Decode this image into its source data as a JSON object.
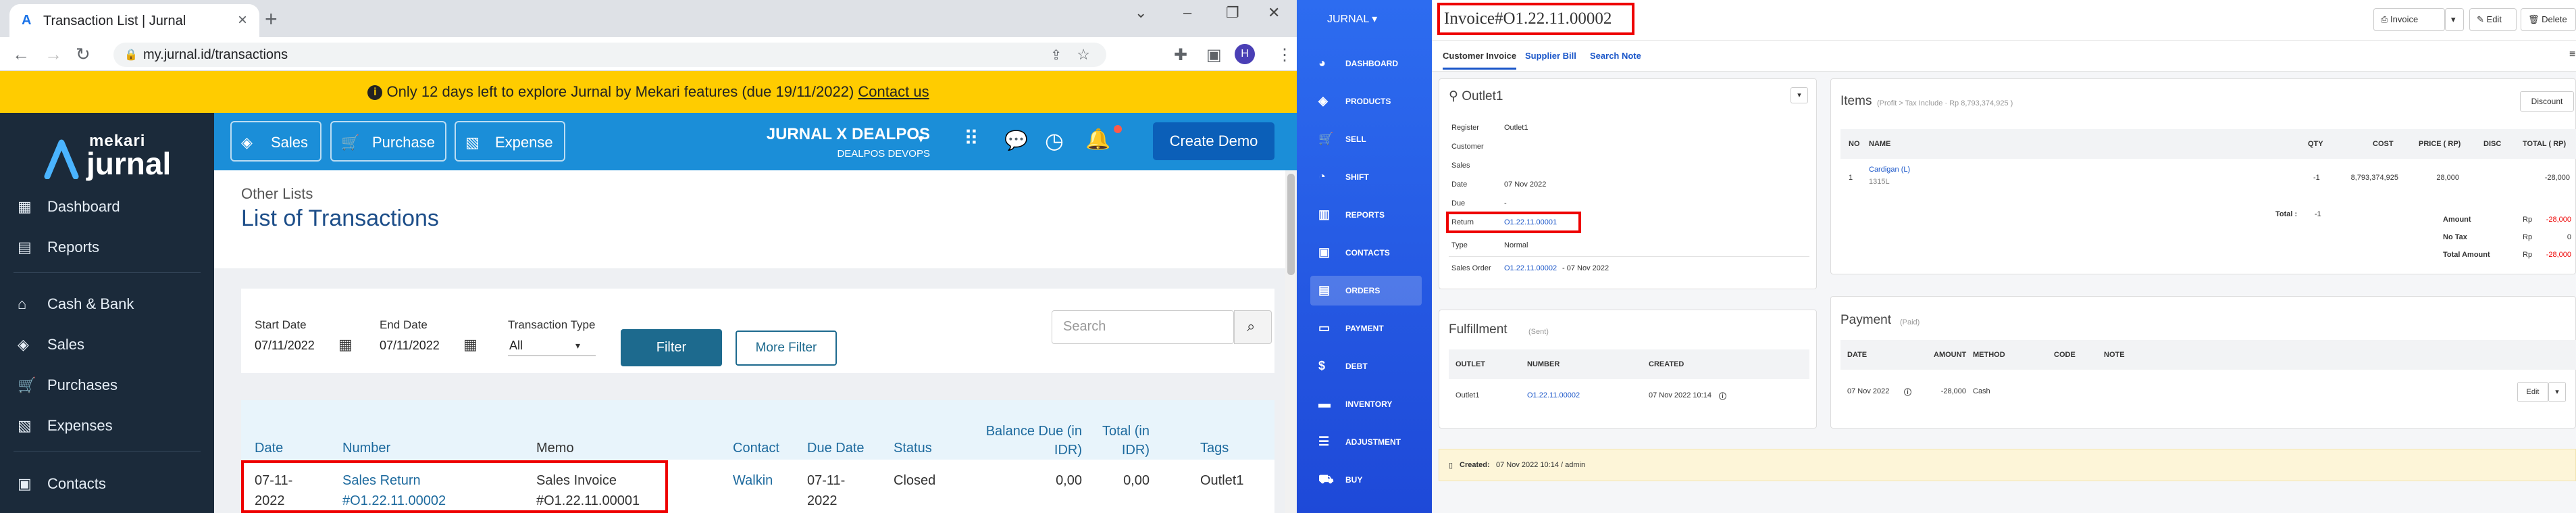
{
  "browser": {
    "tab_title": "Transaction List | Jurnal",
    "url": "my.jurnal.id/transactions",
    "profile_initial": "H"
  },
  "banner": {
    "text": "Only 12 days left to explore Jurnal by Mekari features (due 19/11/2022)",
    "link": "Contact us"
  },
  "jurnal_sidebar": {
    "logo_top": "mekari",
    "logo_bottom": "jurnal",
    "items": [
      "Dashboard",
      "Reports",
      "Cash & Bank",
      "Sales",
      "Purchases",
      "Expenses",
      "Contacts"
    ]
  },
  "jurnal_header": {
    "buttons": [
      "Sales",
      "Purchase",
      "Expense"
    ],
    "company_name": "JURNAL X DEALPOS",
    "company_sub": "DEALPOS DEVOPS",
    "demo_button": "Create Demo"
  },
  "page": {
    "breadcrumb": "Other Lists",
    "title": "List of Transactions"
  },
  "filters": {
    "start_label": "Start Date",
    "start_value": "07/11/2022",
    "end_label": "End Date",
    "end_value": "07/11/2022",
    "type_label": "Transaction Type",
    "type_value": "All",
    "filter_button": "Filter",
    "more_button": "More Filter",
    "search_placeholder": "Search"
  },
  "table": {
    "headers": {
      "date": "Date",
      "number": "Number",
      "memo": "Memo",
      "contact": "Contact",
      "due_date": "Due Date",
      "status": "Status",
      "balance_due": "Balance Due (in IDR)",
      "total": "Total (in IDR)",
      "tags": "Tags"
    },
    "row": {
      "date": "07-11-2022",
      "number": "Sales Return #O1.22.11.00002",
      "memo": "Sales Invoice #O1.22.11.00001",
      "contact": "Walkin",
      "due_date": "07-11-2022",
      "status": "Closed",
      "balance_due": "0,00",
      "total": "0,00",
      "tags": "Outlet1"
    }
  },
  "dealpos_sidebar": {
    "brand": "JURNAL",
    "items": [
      "DASHBOARD",
      "PRODUCTS",
      "SELL",
      "SHIFT",
      "REPORTS",
      "CONTACTS",
      "ORDERS",
      "PAYMENT",
      "DEBT",
      "INVENTORY",
      "ADJUSTMENT",
      "BUY"
    ],
    "active": "ORDERS"
  },
  "invoice": {
    "title": "Invoice#O1.22.11.00002",
    "buttons": {
      "invoice": "Invoice",
      "edit": "Edit",
      "delete": "Delete"
    },
    "tabs": [
      "Customer Invoice",
      "Supplier Bill",
      "Search Note"
    ],
    "outlet_name": "Outlet1",
    "fields": {
      "register_label": "Register",
      "register_value": "Outlet1",
      "customer_label": "Customer",
      "customer_value": "",
      "sales_label": "Sales",
      "sales_value": "",
      "date_label": "Date",
      "date_value": "07 Nov 2022",
      "due_label": "Due",
      "due_value": "-",
      "return_label": "Return",
      "return_value": "O1.22.11.00001",
      "type_label": "Type",
      "type_value": "Normal",
      "sales_order_label": "Sales Order",
      "sales_order_link": "O1.22.11.00002",
      "sales_order_date": "- 07 Nov 2022"
    },
    "items_title": "Items",
    "items_sub": "(Profit > Tax Include · Rp 8,793,374,925 )",
    "discount_button": "Discount",
    "items_headers": [
      "NO",
      "NAME",
      "QTY",
      "COST",
      "PRICE ( RP)",
      "DISC",
      "TOTAL ( RP)"
    ],
    "item": {
      "no": "1",
      "name": "Cardigan (L)",
      "sku": "1315L",
      "qty": "-1",
      "cost": "8,793,374,925",
      "price": "28,000",
      "disc": "",
      "total": "-28,000"
    },
    "total_label": "Total :",
    "total_qty": "-1",
    "amount_label": "Amount",
    "amount_cur": "Rp",
    "amount_value": "-28,000",
    "notax_label": "No Tax",
    "notax_cur": "Rp",
    "notax_value": "0",
    "total_amount_label": "Total Amount",
    "total_amount_cur": "Rp",
    "total_amount_value": "-28,000",
    "fulfillment_title": "Fulfillment",
    "fulfillment_sub": "(Sent)",
    "fulfillment_headers": [
      "OUTLET",
      "NUMBER",
      "CREATED"
    ],
    "fulfillment_row": {
      "outlet": "Outlet1",
      "number": "O1.22.11.00002",
      "created": "07 Nov 2022 10:14"
    },
    "payment_title": "Payment",
    "payment_sub": "(Paid)",
    "payment_headers": [
      "DATE",
      "AMOUNT",
      "METHOD",
      "CODE",
      "NOTE"
    ],
    "payment_row": {
      "date": "07 Nov 2022",
      "amount": "-28,000",
      "method": "Cash",
      "code": "",
      "note": ""
    },
    "payment_edit": "Edit",
    "created_label": "Created:",
    "created_value": "07 Nov 2022 10:14 / admin"
  }
}
